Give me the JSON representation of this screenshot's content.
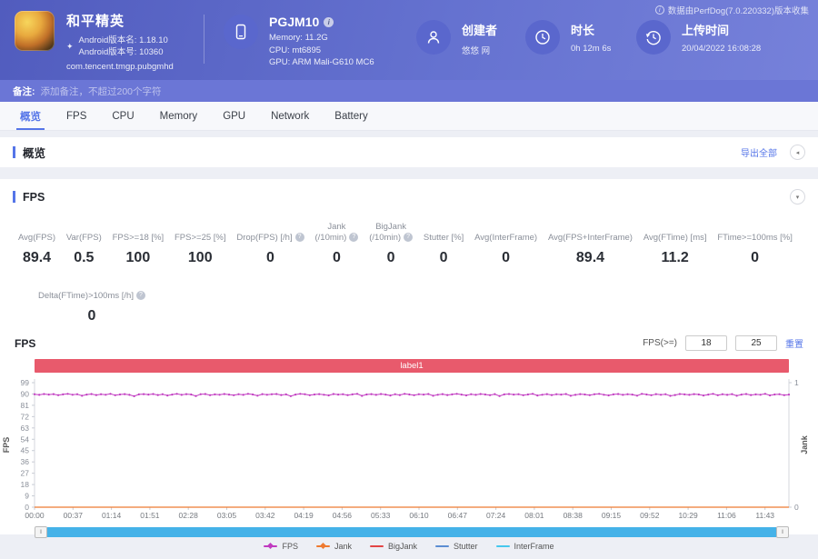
{
  "header": {
    "app": {
      "name": "和平精英",
      "version_name": "Android版本名: 1.18.10",
      "version_code": "Android版本号: 10360",
      "package": "com.tencent.tmgp.pubgmhd"
    },
    "device": {
      "model": "PGJM10",
      "memory": "Memory: 11.2G",
      "cpu": "CPU: mt6895",
      "gpu": "GPU: ARM Mali-G610 MC6"
    },
    "creator": {
      "label": "创建者",
      "value": "悠悠 网"
    },
    "duration": {
      "label": "时长",
      "value": "0h 12m 6s"
    },
    "upload": {
      "label": "上传时间",
      "value": "20/04/2022 16:08:28"
    },
    "collected_by": "数据由PerfDog(7.0.220332)版本收集"
  },
  "note_bar": {
    "label": "备注:",
    "placeholder": "添加备注，不超过200个字符"
  },
  "tabs": [
    {
      "label": "概览",
      "active": true
    },
    {
      "label": "FPS",
      "active": false
    },
    {
      "label": "CPU",
      "active": false
    },
    {
      "label": "Memory",
      "active": false
    },
    {
      "label": "GPU",
      "active": false
    },
    {
      "label": "Network",
      "active": false
    },
    {
      "label": "Battery",
      "active": false
    }
  ],
  "overview_section": {
    "title": "概览",
    "export_all": "导出全部"
  },
  "fps_section": {
    "title": "FPS",
    "stats": [
      {
        "label": "Avg(FPS)",
        "value": "89.4"
      },
      {
        "label": "Var(FPS)",
        "value": "0.5"
      },
      {
        "label": "FPS>=18 [%]",
        "value": "100"
      },
      {
        "label": "FPS>=25 [%]",
        "value": "100"
      },
      {
        "label": "Drop(FPS) [/h]",
        "value": "0",
        "help": true
      },
      {
        "label": "Jank",
        "label2": "(/10min)",
        "value": "0",
        "help": true
      },
      {
        "label": "BigJank",
        "label2": "(/10min)",
        "value": "0",
        "help": true
      },
      {
        "label": "Stutter [%]",
        "value": "0"
      },
      {
        "label": "Avg(InterFrame)",
        "value": "0"
      },
      {
        "label": "Avg(FPS+InterFrame)",
        "value": "89.4"
      },
      {
        "label": "Avg(FTime) [ms]",
        "value": "11.2"
      },
      {
        "label": "FTime>=100ms [%]",
        "value": "0"
      }
    ],
    "stats_row2": [
      {
        "label": "Delta(FTime)>100ms [/h]",
        "value": "0",
        "help": true
      }
    ]
  },
  "chart_data": {
    "type": "line",
    "title": "FPS",
    "region_label": "label1",
    "thresholds": {
      "label": "FPS(>=)",
      "value1": "18",
      "value2": "25",
      "reset": "重置"
    },
    "x_ticks": [
      "00:00",
      "00:37",
      "01:14",
      "01:51",
      "02:28",
      "03:05",
      "03:42",
      "04:19",
      "04:56",
      "05:33",
      "06:10",
      "06:47",
      "07:24",
      "08:01",
      "08:38",
      "09:15",
      "09:52",
      "10:29",
      "11:06",
      "11:43"
    ],
    "x_total_seconds": 726,
    "x_tick_interval_seconds": 37,
    "y_left": {
      "label": "FPS",
      "min": 0,
      "max": 99,
      "tick_step": 9
    },
    "y_right": {
      "label": "Jank",
      "min": 0,
      "max": 1
    },
    "series": [
      {
        "name": "FPS",
        "color": "#c03ac0",
        "marker": "diamond",
        "values": [
          89.8,
          89.3,
          90.0,
          89.5,
          89.9,
          89.1,
          89.7,
          90.1,
          89.4,
          89.8,
          88.6,
          89.5,
          90.0,
          89.2,
          89.8,
          89.4,
          90.1,
          89.0,
          89.6,
          89.9,
          89.3,
          88.2,
          89.7,
          89.9,
          89.5,
          90.0,
          89.2,
          89.8,
          88.8,
          89.5,
          90.1,
          89.3,
          89.9,
          89.6,
          88.4,
          89.8,
          90.0,
          89.1,
          89.7,
          89.4,
          90.0,
          89.5,
          89.0,
          89.8,
          89.3,
          90.1,
          89.6,
          88.7,
          89.9,
          89.4,
          89.8,
          90.0,
          89.2,
          89.7,
          88.3,
          89.5,
          90.1,
          89.8,
          89.0,
          89.6,
          89.9,
          89.4,
          88.9,
          90.0,
          89.5,
          89.8,
          89.1,
          89.7,
          90.1,
          88.5,
          89.6,
          89.9,
          89.3,
          90.0,
          89.5,
          88.8,
          89.8,
          89.2,
          90.1,
          89.6,
          89.0,
          89.8,
          89.5,
          90.0,
          88.6,
          89.4,
          89.9,
          89.2,
          89.7,
          90.1,
          89.5,
          88.9,
          89.8,
          89.3,
          90.0,
          89.6,
          89.1,
          89.9,
          88.4,
          89.7,
          90.0,
          89.5,
          89.8,
          89.0,
          89.6,
          90.1,
          88.8,
          89.4,
          89.9,
          89.2,
          89.8,
          89.5,
          90.0,
          88.6,
          89.3,
          89.9,
          89.6,
          89.1,
          89.8,
          90.1,
          89.4,
          88.9,
          89.7,
          90.0,
          89.3,
          89.8,
          89.5,
          88.7,
          90.1,
          89.6,
          89.0,
          89.9,
          89.4,
          89.8,
          88.5,
          89.2,
          90.0,
          89.7,
          89.3,
          89.9,
          89.6,
          88.8,
          89.5,
          90.1,
          89.0,
          89.8,
          89.3,
          89.9,
          88.6,
          89.5,
          90.0,
          89.2,
          89.7,
          89.4,
          90.1,
          88.9,
          89.6,
          89.8,
          89.1,
          89.5
        ]
      },
      {
        "name": "Jank",
        "color": "#ee7a30",
        "marker": "diamond",
        "constant": 0
      },
      {
        "name": "BigJank",
        "color": "#e34545",
        "marker": "line"
      },
      {
        "name": "Stutter",
        "color": "#5b8dd2",
        "marker": "line"
      },
      {
        "name": "InterFrame",
        "color": "#45c8ee",
        "marker": "line"
      }
    ],
    "legend_position": "bottom"
  }
}
